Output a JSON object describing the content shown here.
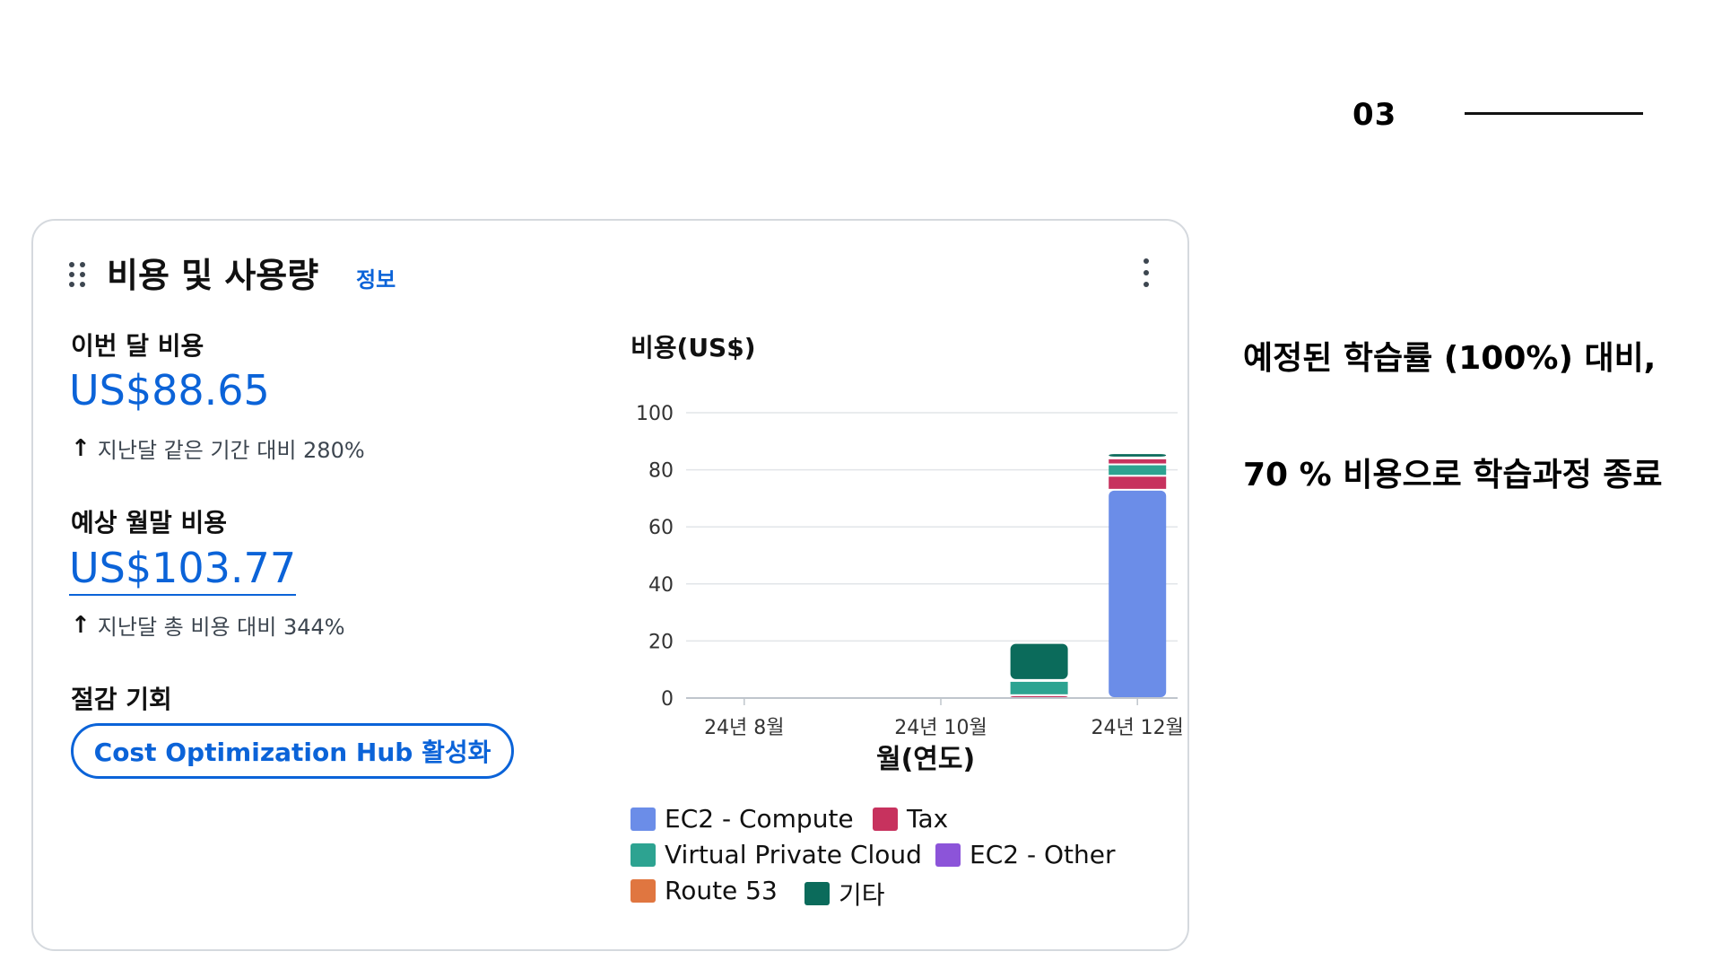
{
  "page": {
    "number": "03",
    "side_notes": [
      "예정된 학습률 (100%) 대비,",
      "70 % 비용으로 학습과정 종료"
    ]
  },
  "widget": {
    "title": "비용 및 사용량",
    "info_link": "정보",
    "current_month": {
      "label": "이번 달 비용",
      "amount": "US$88.65",
      "change_text": "지난달 같은 기간 대비 280%"
    },
    "forecast": {
      "label": "예상 월말 비용",
      "amount": "US$103.77",
      "change_text": "지난달 총 비용 대비 344%"
    },
    "savings": {
      "label": "절감 기회",
      "button_label": "Cost Optimization Hub 활성화"
    }
  },
  "chart_data": {
    "type": "bar",
    "stacked": true,
    "ylabel": "비용(US$)",
    "xlabel": "월(연도)",
    "ylim": [
      0,
      100
    ],
    "yticks": [
      0,
      20,
      40,
      60,
      80,
      100
    ],
    "x_tick_labels": [
      "24년 8월",
      "24년 10월",
      "24년 12월"
    ],
    "categories": [
      "24년 11월",
      "24년 12월"
    ],
    "series": [
      {
        "name": "EC2 - Compute",
        "color": "#6b8de8",
        "values": [
          0,
          73
        ]
      },
      {
        "name": "Tax",
        "color": "#c7325e",
        "values": [
          1,
          7
        ]
      },
      {
        "name": "Virtual Private Cloud",
        "color": "#2da391",
        "values": [
          5,
          4
        ]
      },
      {
        "name": "EC2 - Other",
        "color": "#8c54d9",
        "values": [
          0,
          0
        ]
      },
      {
        "name": "Route 53",
        "color": "#e07640",
        "values": [
          0,
          0
        ]
      },
      {
        "name": "기타",
        "color": "#0b6b5b",
        "values": [
          13,
          1.5
        ]
      }
    ],
    "grid": true,
    "legend_position": "bottom"
  }
}
